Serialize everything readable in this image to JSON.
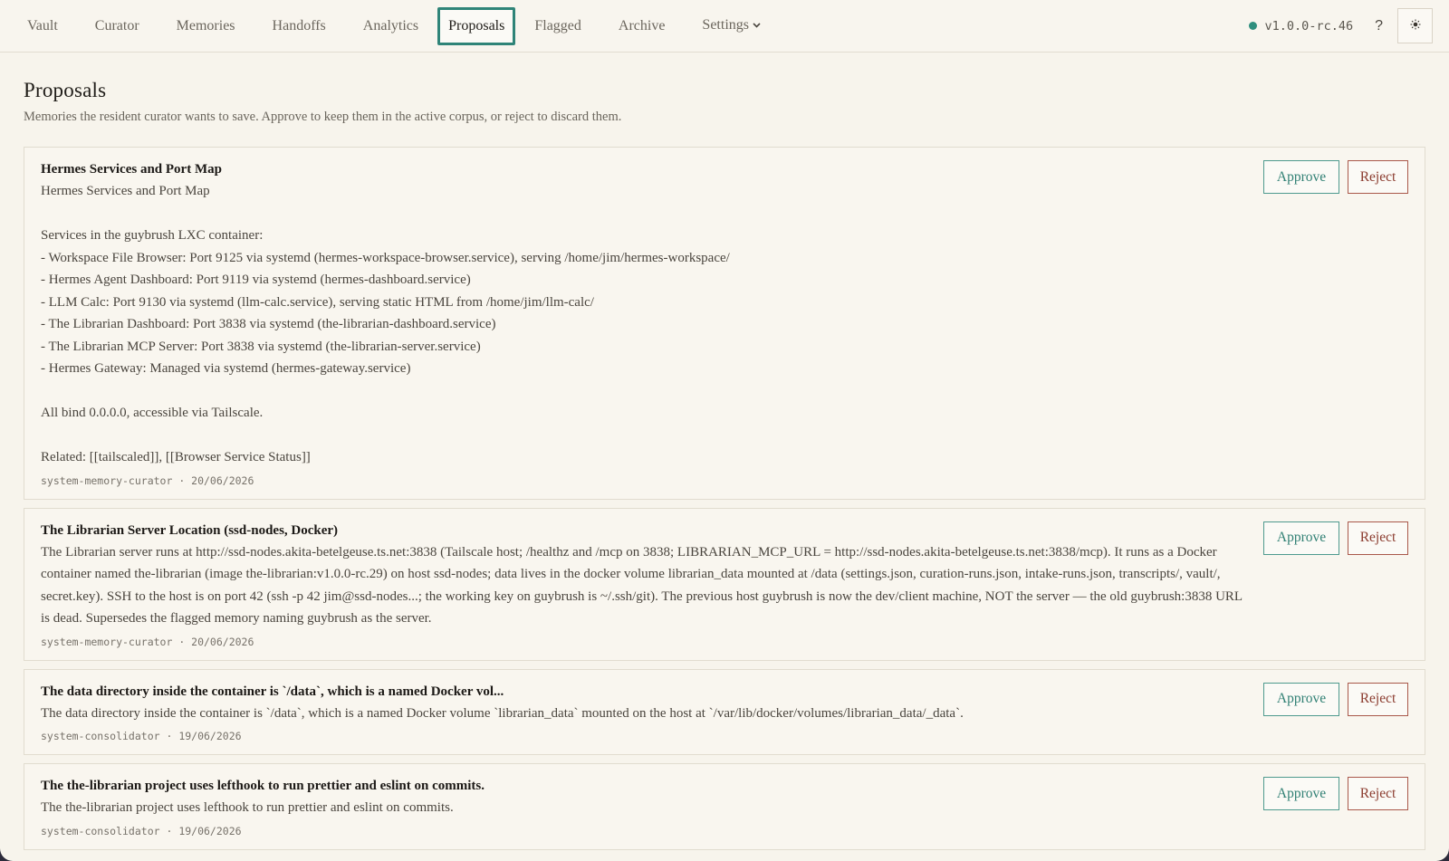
{
  "nav": {
    "items": [
      {
        "label": "Vault",
        "active": false
      },
      {
        "label": "Curator",
        "active": false
      },
      {
        "label": "Memories",
        "active": false
      },
      {
        "label": "Handoffs",
        "active": false
      },
      {
        "label": "Analytics",
        "active": false
      },
      {
        "label": "Proposals",
        "active": true
      },
      {
        "label": "Flagged",
        "active": false
      },
      {
        "label": "Archive",
        "active": false
      },
      {
        "label": "Settings",
        "active": false
      }
    ],
    "settings_chevron": "chevron-down-icon",
    "version": "v1.0.0-rc.46",
    "status_color": "#2f8f7e",
    "help_label": "?",
    "theme_icon": "sun-icon"
  },
  "page": {
    "title": "Proposals",
    "subtitle": "Memories the resident curator wants to save. Approve to keep them in the active corpus, or reject to discard them."
  },
  "actions": {
    "approve_label": "Approve",
    "reject_label": "Reject"
  },
  "proposals": [
    {
      "title": "Hermes Services and Port Map",
      "body": "Hermes Services and Port Map\n\nServices in the guybrush LXC container:\n- Workspace File Browser: Port 9125 via systemd (hermes-workspace-browser.service), serving /home/jim/hermes-workspace/\n- Hermes Agent Dashboard: Port 9119 via systemd (hermes-dashboard.service)\n- LLM Calc: Port 9130 via systemd (llm-calc.service), serving static HTML from /home/jim/llm-calc/\n- The Librarian Dashboard: Port 3838 via systemd (the-librarian-dashboard.service)\n- The Librarian MCP Server: Port 3838 via systemd (the-librarian-server.service)\n- Hermes Gateway: Managed via systemd (hermes-gateway.service)\n\nAll bind 0.0.0.0, accessible via Tailscale.\n\nRelated: [[tailscaled]], [[Browser Service Status]]",
      "meta": "system-memory-curator · 20/06/2026"
    },
    {
      "title": "The Librarian Server Location (ssd-nodes, Docker)",
      "body": "The Librarian server runs at http://ssd-nodes.akita-betelgeuse.ts.net:3838 (Tailscale host; /healthz and /mcp on 3838; LIBRARIAN_MCP_URL = http://ssd-nodes.akita-betelgeuse.ts.net:3838/mcp). It runs as a Docker container named the-librarian (image the-librarian:v1.0.0-rc.29) on host ssd-nodes; data lives in the docker volume librarian_data mounted at /data (settings.json, curation-runs.json, intake-runs.json, transcripts/, vault/, secret.key). SSH to the host is on port 42 (ssh -p 42 jim@ssd-nodes...; the working key on guybrush is ~/.ssh/git). The previous host guybrush is now the dev/client machine, NOT the server — the old guybrush:3838 URL is dead. Supersedes the flagged memory naming guybrush as the server.",
      "meta": "system-memory-curator · 20/06/2026"
    },
    {
      "title": "The data directory inside the container is `/data`, which is a named Docker vol...",
      "body": "The data directory inside the container is `/data`, which is a named Docker volume `librarian_data` mounted on the host at `/var/lib/docker/volumes/librarian_data/_data`.",
      "meta": "system-consolidator · 19/06/2026"
    },
    {
      "title": "The the-librarian project uses lefthook to run prettier and eslint on commits.",
      "body": "The the-librarian project uses lefthook to run prettier and eslint on commits.",
      "meta": "system-consolidator · 19/06/2026"
    }
  ]
}
